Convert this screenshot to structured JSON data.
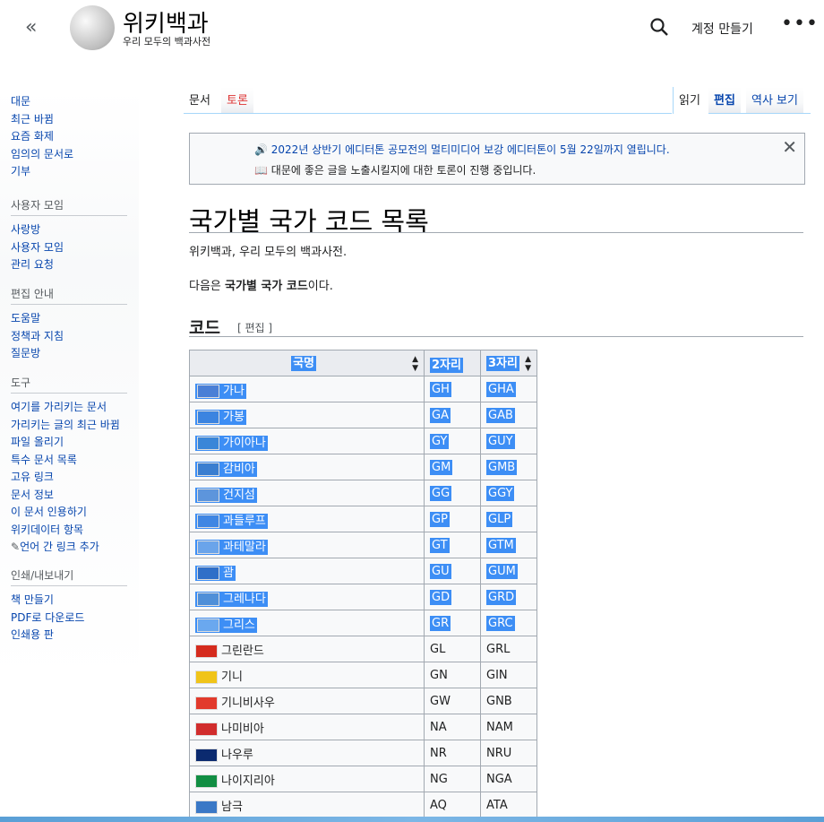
{
  "header": {
    "collapse_glyph": "«",
    "site_title": "위키백과",
    "tagline": "우리 모두의 백과사전",
    "create_account": "계정 만들기",
    "more_glyph": "•••"
  },
  "sidebar": {
    "main": [
      "대문",
      "최근 바뀜",
      "요즘 화제",
      "임의의 문서로",
      "기부"
    ],
    "community": {
      "heading": "사용자 모임",
      "items": [
        "사랑방",
        "사용자 모임",
        "관리 요청"
      ]
    },
    "editing": {
      "heading": "편집 안내",
      "items": [
        "도움말",
        "정책과 지침",
        "질문방"
      ]
    },
    "tools": {
      "heading": "도구",
      "items": [
        "여기를 가리키는 문서",
        "가리키는 글의 최근 바뀜",
        "파일 올리기",
        "특수 문서 목록",
        "고유 링크",
        "문서 정보",
        "이 문서 인용하기",
        "위키데이터 항목",
        "언어 간 링크 추가"
      ]
    },
    "print": {
      "heading": "인쇄/내보내기",
      "items": [
        "책 만들기",
        "PDF로 다운로드",
        "인쇄용 판"
      ]
    }
  },
  "tabs": {
    "article": "문서",
    "talk": "토론",
    "read": "읽기",
    "edit": "편집",
    "history": "역사 보기"
  },
  "notice": {
    "line1": "2022년 상반기 에디터톤 공모전의 멀티미디어 보강 에디터톤이 5월 22일까지 열립니다.",
    "line2": "대문에 좋은 글을 노출시킬지에 대한 토론이 진행 중입니다.",
    "close": "✕"
  },
  "article": {
    "title": "국가별 국가 코드 목록",
    "subtitle": "위키백과, 우리 모두의 백과사전.",
    "intro_prefix": "다음은 ",
    "intro_bold": "국가별 국가 코드",
    "intro_suffix": "이다.",
    "section": "코드",
    "section_edit": "[ 편집 ]"
  },
  "table": {
    "headers": [
      "국명",
      "2자리",
      "3자리"
    ],
    "rows": [
      {
        "name": "가나",
        "a2": "GH",
        "a3": "GHA",
        "selected": true,
        "flag": "#4a7fd6"
      },
      {
        "name": "가봉",
        "a2": "GA",
        "a3": "GAB",
        "selected": true,
        "flag": "#3b84e0"
      },
      {
        "name": "가이아나",
        "a2": "GY",
        "a3": "GUY",
        "selected": true,
        "flag": "#3a86d8"
      },
      {
        "name": "감비아",
        "a2": "GM",
        "a3": "GMB",
        "selected": true,
        "flag": "#3a7ed0"
      },
      {
        "name": "건지섬",
        "a2": "GG",
        "a3": "GGY",
        "selected": true,
        "flag": "#5d95dc"
      },
      {
        "name": "과들루프",
        "a2": "GP",
        "a3": "GLP",
        "selected": true,
        "flag": "#3f86e3"
      },
      {
        "name": "과테말라",
        "a2": "GT",
        "a3": "GTM",
        "selected": true,
        "flag": "#6aa4ea"
      },
      {
        "name": "괌",
        "a2": "GU",
        "a3": "GUM",
        "selected": true,
        "flag": "#2f6fc8"
      },
      {
        "name": "그레나다",
        "a2": "GD",
        "a3": "GRD",
        "selected": true,
        "flag": "#4f8fd8"
      },
      {
        "name": "그리스",
        "a2": "GR",
        "a3": "GRC",
        "selected": true,
        "flag": "#6aa8ef"
      },
      {
        "name": "그린란드",
        "a2": "GL",
        "a3": "GRL",
        "selected": false,
        "flag": "#d52b1e"
      },
      {
        "name": "기니",
        "a2": "GN",
        "a3": "GIN",
        "selected": false,
        "flag": "#f0c419"
      },
      {
        "name": "기니비사우",
        "a2": "GW",
        "a3": "GNB",
        "selected": false,
        "flag": "#e23a2c"
      },
      {
        "name": "나미비아",
        "a2": "NA",
        "a3": "NAM",
        "selected": false,
        "flag": "#d12d2d"
      },
      {
        "name": "나우루",
        "a2": "NR",
        "a3": "NRU",
        "selected": false,
        "flag": "#0b2a6f"
      },
      {
        "name": "나이지리아",
        "a2": "NG",
        "a3": "NGA",
        "selected": false,
        "flag": "#118e43"
      },
      {
        "name": "남극",
        "a2": "AQ",
        "a3": "ATA",
        "selected": false,
        "flag": "#3a78c6"
      }
    ]
  }
}
